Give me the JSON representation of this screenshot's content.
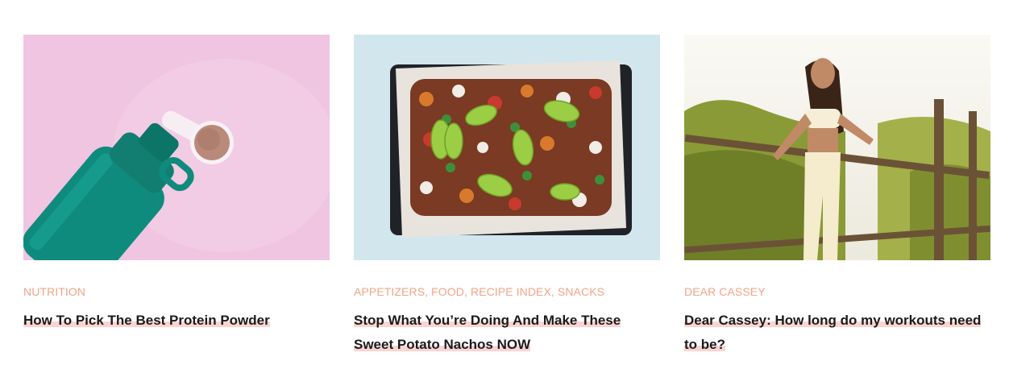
{
  "articles": [
    {
      "category": "NUTRITION",
      "title": "How To Pick The Best Protein Powder",
      "image_subject": "teal-shaker-bottle-and-protein-scoop-on-pink"
    },
    {
      "category": "APPETIZERS, FOOD, RECIPE INDEX, SNACKS",
      "title": "Stop What You’re Doing And Make These Sweet Potato Nachos NOW",
      "image_subject": "sweet-potato-nachos-on-baking-tray"
    },
    {
      "category": "DEAR CASSEY",
      "title": "Dear Cassey: How long do my workouts need to be?",
      "image_subject": "woman-in-yellow-activewear-by-wooden-fence"
    }
  ],
  "colors": {
    "category_text": "#f2a487",
    "title_text": "#1b1b1b",
    "title_highlight": "#fbd4d2",
    "image1_background": "#efc5e1",
    "image1_bottle": "#0f8b7d",
    "image2_background": "#d2e6ee",
    "image2_tray": "#1f2328",
    "image3_sky": "#f5f3ee",
    "image3_foliage": "#8a9a36"
  }
}
